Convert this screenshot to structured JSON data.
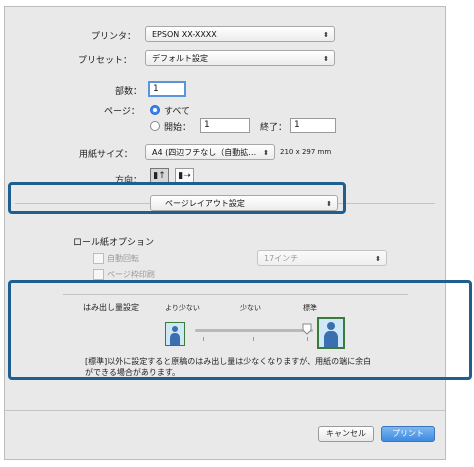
{
  "printer": {
    "label": "プリンタ：",
    "value": "EPSON XX-XXXX"
  },
  "preset": {
    "label": "プリセット：",
    "value": "デフォルト設定"
  },
  "copies": {
    "label": "部数：",
    "value": "1"
  },
  "pages": {
    "label": "ページ：",
    "all_label": "すべて",
    "from_label": "開始：",
    "from_value": "1",
    "to_label": "終了：",
    "to_value": "1"
  },
  "paper_size": {
    "label": "用紙サイズ：",
    "value": "A4 (四辺フチなし（自動拡…",
    "dimensions": "210 x 297 mm"
  },
  "orientation": {
    "label": "方向："
  },
  "panel_select": {
    "value": "ページレイアウト設定"
  },
  "roll_options": {
    "title": "ロール紙オプション",
    "auto_rotate": "自動回転",
    "page_frame": "ページ枠印刷",
    "roll_width": "17インチ"
  },
  "overflow": {
    "label": "はみ出し量設定",
    "option_less_more": "より少ない",
    "option_less": "少ない",
    "option_standard": "標準",
    "selected_level": "標準",
    "note_line1": "[標準]以外に設定すると原稿のはみ出し量は少なくなりますが、用紙の端に余白",
    "note_line2": "ができる場合があります。"
  },
  "footer": {
    "cancel_label": "キャンセル",
    "print_label": "プリント"
  },
  "colors": {
    "highlight": "#1f5f8f",
    "accent": "#3e8ae0"
  }
}
